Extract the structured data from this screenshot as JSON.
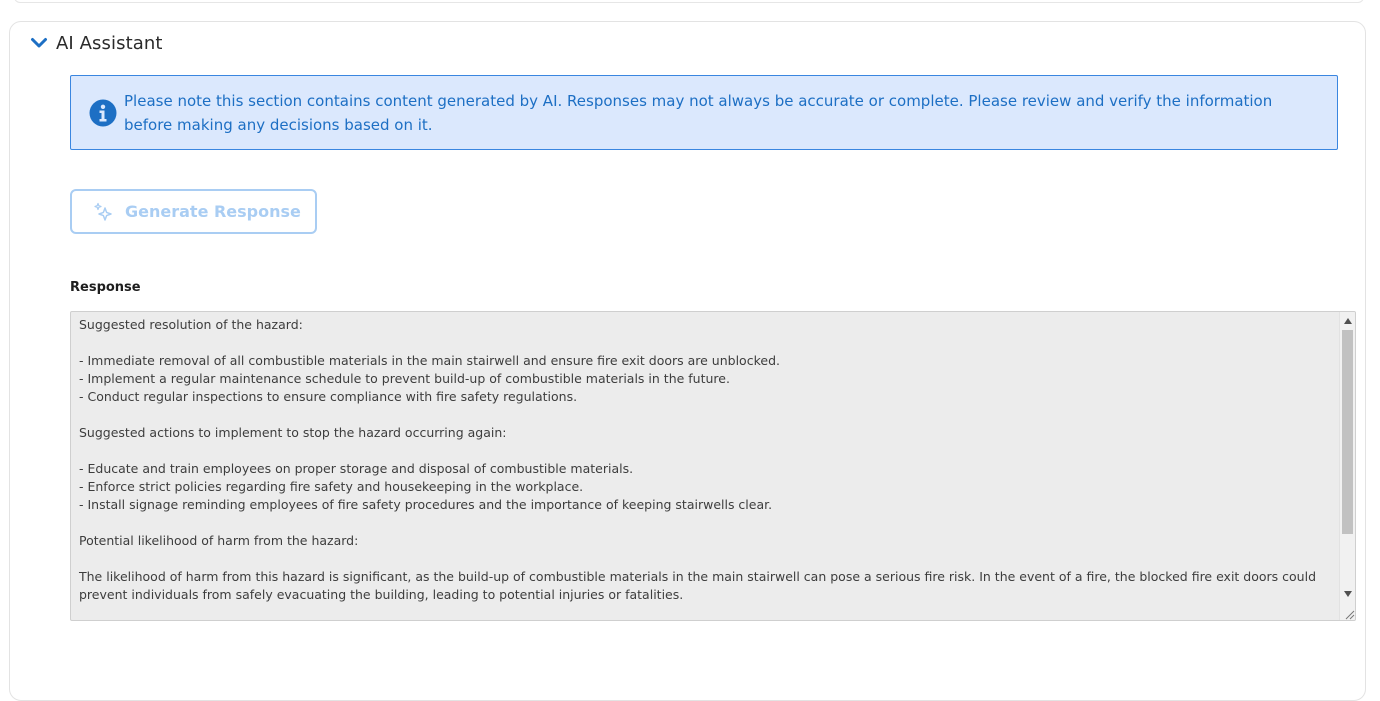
{
  "section": {
    "title": "AI Assistant",
    "toggle_icon": "chevron-down-icon"
  },
  "notice": {
    "icon": "info-icon",
    "text": "Please note this section contains content generated by AI. Responses may not always be accurate or complete. Please review and verify the information before making any decisions based on it."
  },
  "generate_button": {
    "icon": "sparkle-icon",
    "label": "Generate Response",
    "disabled": true
  },
  "response": {
    "label": "Response",
    "lines": [
      "Suggested resolution of the hazard:",
      "",
      "- Immediate removal of all combustible materials in the main stairwell and ensure fire exit doors are unblocked.",
      "- Implement a regular maintenance schedule to prevent build-up of combustible materials in the future.",
      "- Conduct regular inspections to ensure compliance with fire safety regulations.",
      "",
      "Suggested actions to implement to stop the hazard occurring again:",
      "",
      "- Educate and train employees on proper storage and disposal of combustible materials.",
      "- Enforce strict policies regarding fire safety and housekeeping in the workplace.",
      "- Install signage reminding employees of fire safety procedures and the importance of keeping stairwells clear.",
      "",
      "Potential likelihood of harm from the hazard:",
      "",
      "The likelihood of harm from this hazard is significant, as the build-up of combustible materials in the main stairwell can pose a serious fire risk. In the event of a fire, the blocked fire exit doors could prevent individuals from safely evacuating the building, leading to potential injuries or fatalities."
    ]
  },
  "colors": {
    "accent": "#1d6fc4",
    "notice_bg": "#dbe8fd",
    "notice_border": "#3a86e0",
    "button_disabled": "#a9cdf3",
    "textarea_bg": "#ececec"
  }
}
